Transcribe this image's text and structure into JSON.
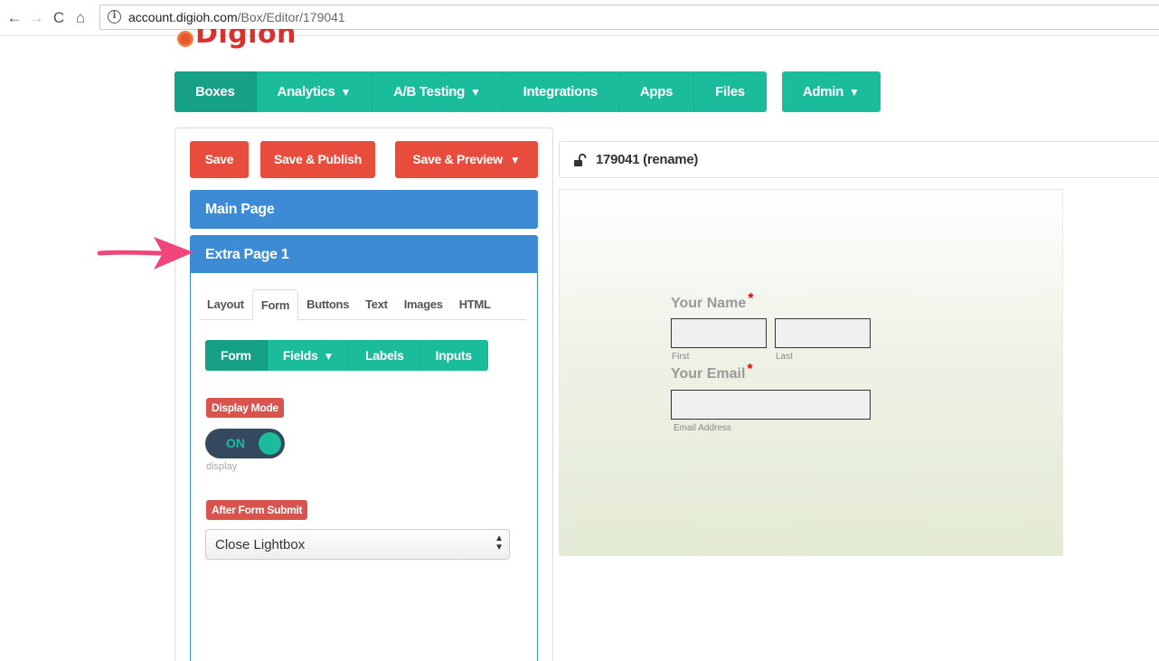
{
  "browser": {
    "back_icon": "←",
    "forward_icon": "→",
    "reload_icon": "C",
    "home_icon": "⌂",
    "info_icon": "i",
    "url_host": "account.digioh.com",
    "url_path": "/Box/Editor/179041"
  },
  "logo": {
    "text": "Digioh"
  },
  "topnav": {
    "items": [
      {
        "label": "Boxes"
      },
      {
        "label": "Analytics",
        "caret": "▼"
      },
      {
        "label": "A/B Testing",
        "caret": "▼"
      },
      {
        "label": "Integrations"
      },
      {
        "label": "Apps"
      },
      {
        "label": "Files"
      }
    ],
    "admin": {
      "label": "Admin",
      "caret": "▼"
    }
  },
  "toolbar": {
    "save": "Save",
    "save_publish": "Save & Publish",
    "save_preview": "Save & Preview",
    "caret": "▼"
  },
  "pages": {
    "main": "Main Page",
    "extra": "Extra Page 1"
  },
  "subtabs": [
    "Layout",
    "Form",
    "Buttons",
    "Text",
    "Images",
    "HTML"
  ],
  "formtabs": {
    "form": "Form",
    "fields": "Fields",
    "labels": "Labels",
    "inputs": "Inputs",
    "caret": "▼"
  },
  "display_mode": {
    "label": "Display Mode",
    "toggle_state": "ON",
    "caption": "display"
  },
  "after_submit": {
    "label": "After Form Submit",
    "selected": "Close Lightbox",
    "arrows": "▲▼"
  },
  "box_title": "179041 (rename)",
  "preview": {
    "name_label": "Your Name",
    "required_mark": "*",
    "first_caption": "First",
    "last_caption": "Last",
    "email_label": "Your Email",
    "email_caption": "Email Address"
  },
  "colors": {
    "teal": "#1abc9c",
    "teal_dark": "#16a085",
    "red": "#e74c3c",
    "blue": "#3d8bd4",
    "annotation_pink": "#f0457a"
  }
}
